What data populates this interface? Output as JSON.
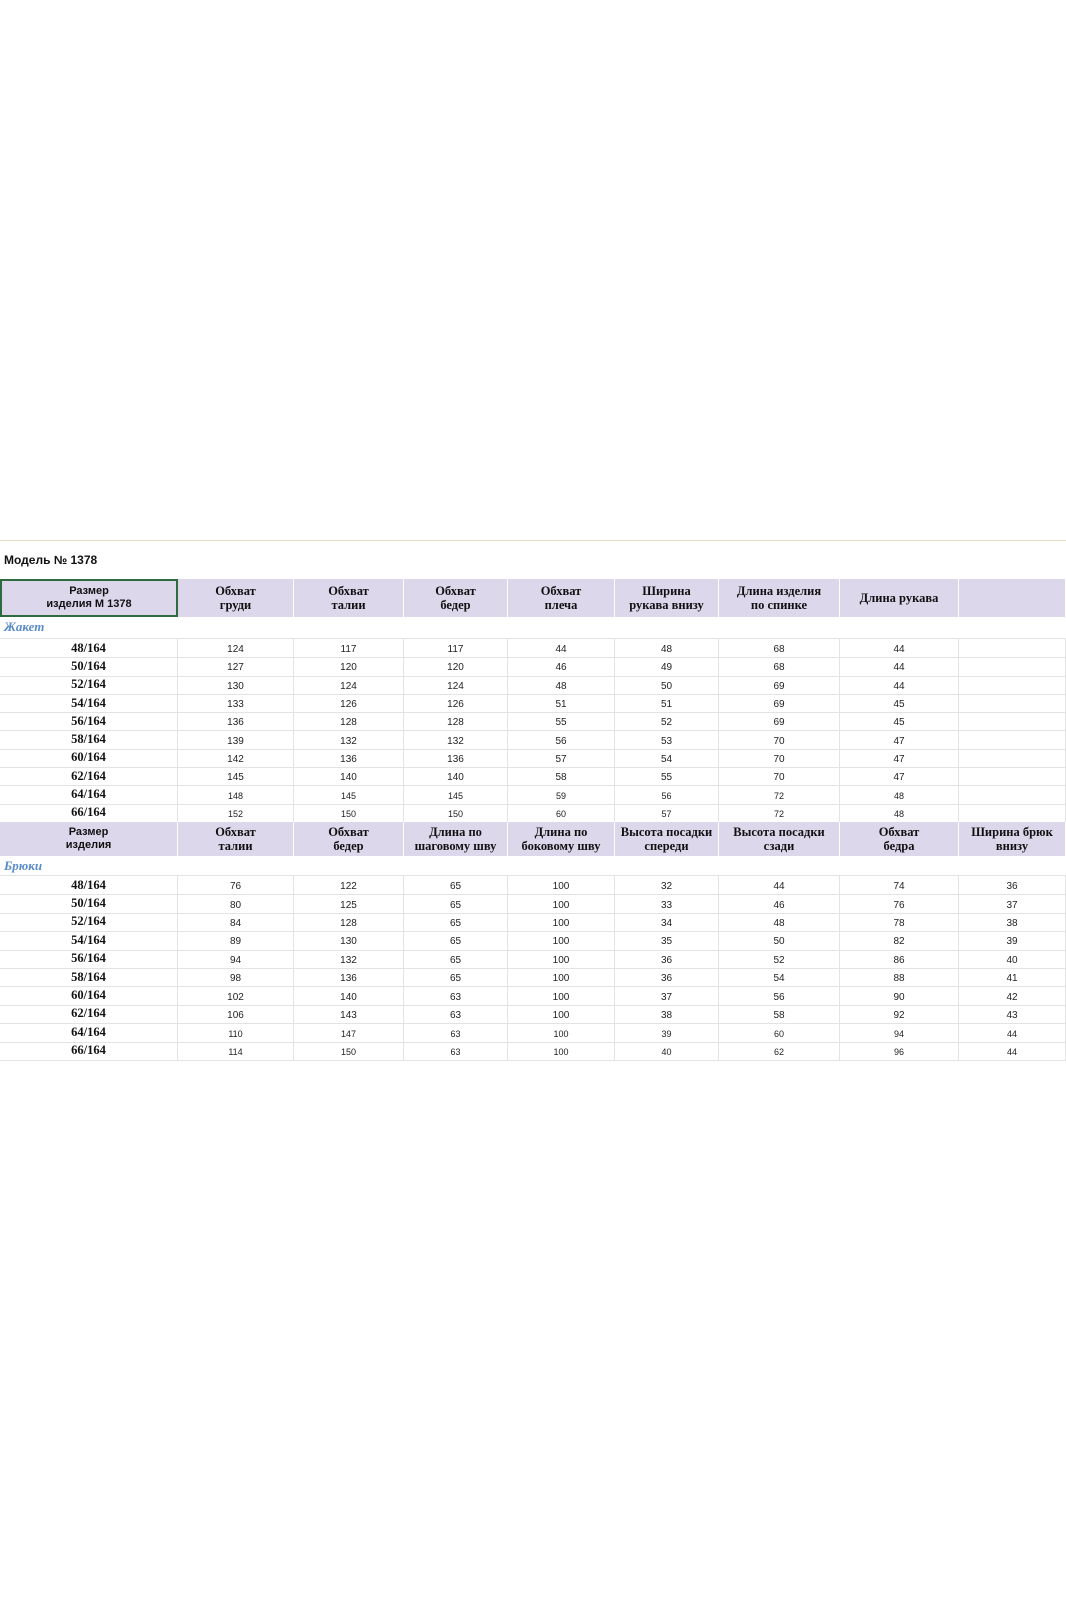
{
  "model_title": "Модель №  1378",
  "jacket": {
    "section_label": "Жакет",
    "header": [
      "Размер\nизделия М 1378",
      "Обхват\nгруди",
      "Обхват\nталии",
      "Обхват\nбедер",
      "Обхват\nплеча",
      "Ширина\nрукава внизу",
      "Длина изделия\nпо спинке",
      "Длина рукава",
      ""
    ],
    "rows": [
      {
        "size": "48/164",
        "values": [
          "124",
          "117",
          "117",
          "44",
          "48",
          "68",
          "44",
          ""
        ]
      },
      {
        "size": "50/164",
        "values": [
          "127",
          "120",
          "120",
          "46",
          "49",
          "68",
          "44",
          ""
        ]
      },
      {
        "size": "52/164",
        "values": [
          "130",
          "124",
          "124",
          "48",
          "50",
          "69",
          "44",
          ""
        ]
      },
      {
        "size": "54/164",
        "values": [
          "133",
          "126",
          "126",
          "51",
          "51",
          "69",
          "45",
          ""
        ]
      },
      {
        "size": "56/164",
        "values": [
          "136",
          "128",
          "128",
          "55",
          "52",
          "69",
          "45",
          ""
        ]
      },
      {
        "size": "58/164",
        "values": [
          "139",
          "132",
          "132",
          "56",
          "53",
          "70",
          "47",
          ""
        ]
      },
      {
        "size": "60/164",
        "values": [
          "142",
          "136",
          "136",
          "57",
          "54",
          "70",
          "47",
          ""
        ]
      },
      {
        "size": "62/164",
        "values": [
          "145",
          "140",
          "140",
          "58",
          "55",
          "70",
          "47",
          ""
        ]
      },
      {
        "size": "64/164",
        "values": [
          "148",
          "145",
          "145",
          "59",
          "56",
          "72",
          "48",
          ""
        ]
      },
      {
        "size": "66/164",
        "values": [
          "152",
          "150",
          "150",
          "60",
          "57",
          "72",
          "48",
          ""
        ]
      }
    ]
  },
  "trousers": {
    "section_label": "Брюки",
    "header": [
      "Размер\nизделия",
      "Обхват\nталии",
      "Обхват\nбедер",
      "Длина по\nшаговому шву",
      "Длина по\nбоковому шву",
      "Высота посадки\nспереди",
      "Высота посадки\nсзади",
      "Обхват\nбедра",
      "Ширина брюк\nвнизу"
    ],
    "rows": [
      {
        "size": "48/164",
        "values": [
          "76",
          "122",
          "65",
          "100",
          "32",
          "44",
          "74",
          "36"
        ]
      },
      {
        "size": "50/164",
        "values": [
          "80",
          "125",
          "65",
          "100",
          "33",
          "46",
          "76",
          "37"
        ]
      },
      {
        "size": "52/164",
        "values": [
          "84",
          "128",
          "65",
          "100",
          "34",
          "48",
          "78",
          "38"
        ]
      },
      {
        "size": "54/164",
        "values": [
          "89",
          "130",
          "65",
          "100",
          "35",
          "50",
          "82",
          "39"
        ]
      },
      {
        "size": "56/164",
        "values": [
          "94",
          "132",
          "65",
          "100",
          "36",
          "52",
          "86",
          "40"
        ]
      },
      {
        "size": "58/164",
        "values": [
          "98",
          "136",
          "65",
          "100",
          "36",
          "54",
          "88",
          "41"
        ]
      },
      {
        "size": "60/164",
        "values": [
          "102",
          "140",
          "63",
          "100",
          "37",
          "56",
          "90",
          "42"
        ]
      },
      {
        "size": "62/164",
        "values": [
          "106",
          "143",
          "63",
          "100",
          "38",
          "58",
          "92",
          "43"
        ]
      },
      {
        "size": "64/164",
        "values": [
          "110",
          "147",
          "63",
          "100",
          "39",
          "60",
          "94",
          "44"
        ]
      },
      {
        "size": "66/164",
        "values": [
          "114",
          "150",
          "63",
          "100",
          "40",
          "62",
          "96",
          "44"
        ]
      }
    ]
  }
}
